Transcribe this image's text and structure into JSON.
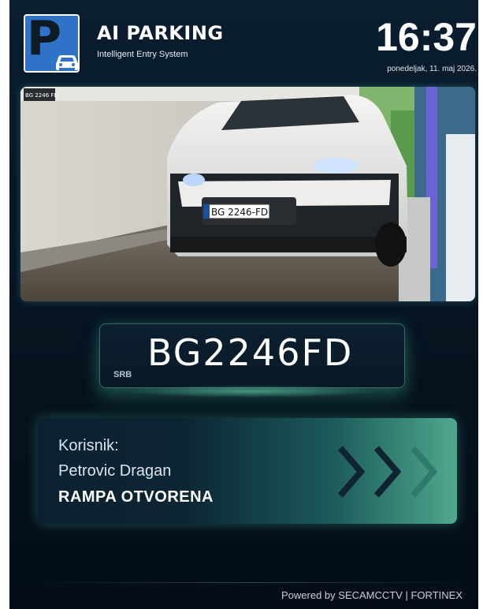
{
  "header": {
    "app_title": "AI PARKING",
    "subtitle": "Intelligent Entry System",
    "time": "16:37",
    "date": "ponedeljak, 11. maj 2026."
  },
  "logo": {
    "letter": "P",
    "icon": "car-icon",
    "color": "#2f73c9"
  },
  "camera": {
    "icon": "camera-feed",
    "car_plate_text": "BG 2246-FD",
    "corner_tag": "BG 2246 FD"
  },
  "plate": {
    "country": "SRB",
    "number": "BG2246FD"
  },
  "status": {
    "label": "Korisnik:",
    "user_name": "Petrovic Dragan",
    "state": "RAMPA OTVORENA",
    "icon": "chevron-right-icon"
  },
  "footer": {
    "powered_by": "Powered by SECAMCCTV | FORTINEX"
  },
  "colors": {
    "accent": "#4fa88d",
    "background": "#071827",
    "logo_blue": "#2f73c9"
  }
}
